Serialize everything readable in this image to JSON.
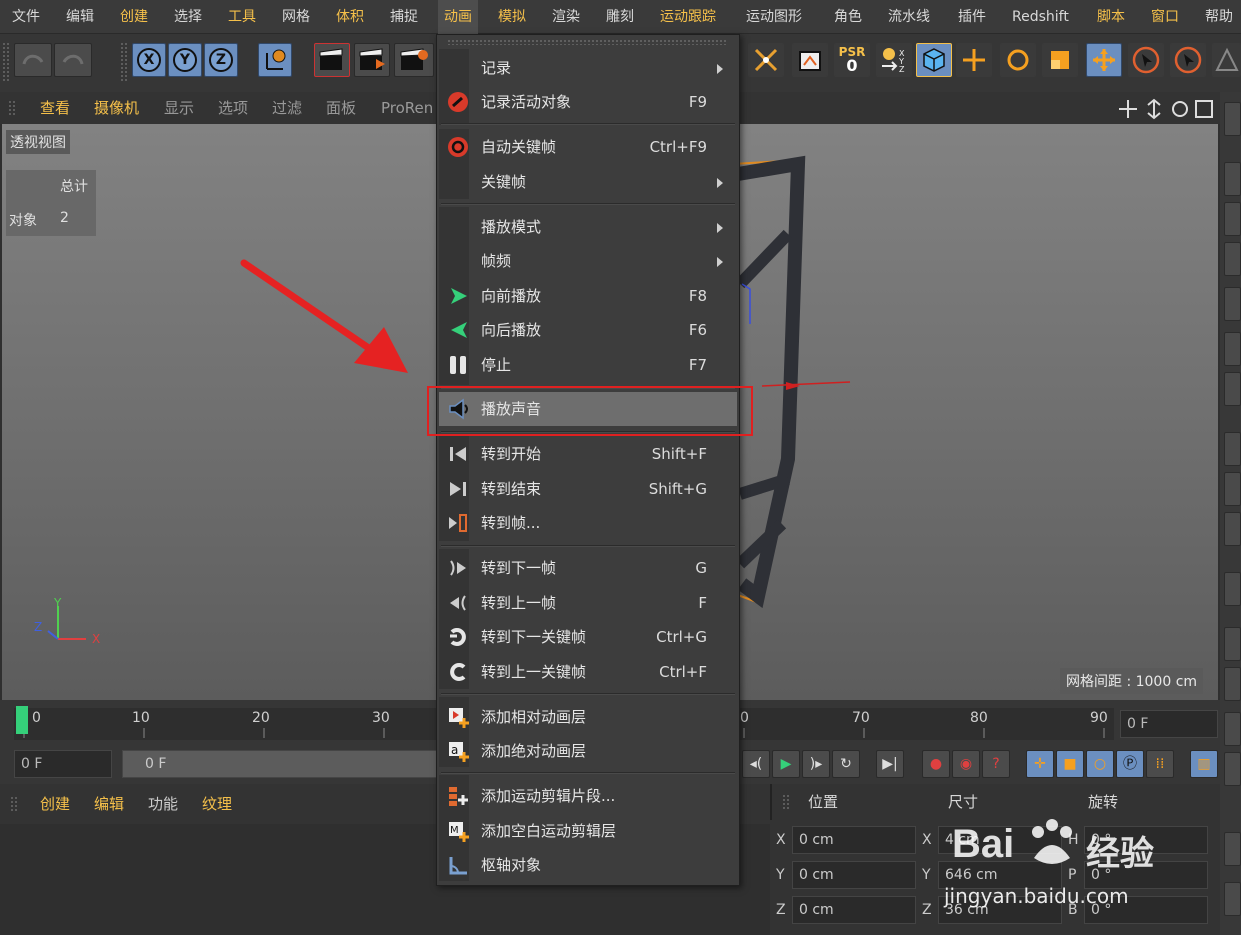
{
  "menubar": {
    "items": [
      "文件",
      "编辑",
      "创建",
      "选择",
      "工具",
      "网格",
      "体积",
      "捕捉",
      "动画",
      "模拟",
      "渲染",
      "雕刻",
      "运动跟踪",
      "运动图形",
      "角色",
      "流水线",
      "插件",
      "Redshift",
      "脚本",
      "窗口",
      "帮助"
    ]
  },
  "toolbar": {
    "x_label": "X",
    "y_label": "Y",
    "z_label": "Z",
    "psr_label": "PSR",
    "psr_value": "0"
  },
  "viewport_bar": {
    "items": [
      "查看",
      "摄像机",
      "显示",
      "选项",
      "过滤",
      "面板",
      "ProRen"
    ]
  },
  "viewport": {
    "label": "透视视图",
    "stats_header": "总计",
    "stats_row_label": "对象",
    "stats_row_value": "2",
    "grid_spacing": "网格间距 : 1000 cm",
    "axis_y": "Y",
    "axis_z": "Z",
    "axis_x": "X"
  },
  "timeline": {
    "ticks": [
      "0",
      "10",
      "20",
      "30",
      "",
      "70",
      "80",
      "90"
    ],
    "tick_last_hidden": "0",
    "frame_right": "0 F",
    "frame_left": "0 F",
    "slider_value": "0 F"
  },
  "bottom_bar": {
    "items": [
      "创建",
      "编辑",
      "功能",
      "纹理"
    ]
  },
  "attributes": {
    "headers": [
      "位置",
      "尺寸",
      "旋转"
    ],
    "rows": [
      {
        "axis": "X",
        "pos": "0 cm",
        "size": "4 cm",
        "rot_axis": "H",
        "rot": "0 °"
      },
      {
        "axis": "Y",
        "pos": "0 cm",
        "size": "646 cm",
        "rot_axis": "P",
        "rot": "0 °"
      },
      {
        "axis": "Z",
        "pos": "0 cm",
        "size": "36 cm",
        "rot_axis": "B",
        "rot": "0 °"
      }
    ]
  },
  "menu": {
    "items": [
      {
        "label": "记录",
        "shortcut": "",
        "submenu": true,
        "icon": "none"
      },
      {
        "label": "记录活动对象",
        "shortcut": "F9",
        "submenu": false,
        "icon": "record-icon"
      },
      {
        "label": "自动关键帧",
        "shortcut": "Ctrl+F9",
        "submenu": false,
        "icon": "autokey-icon"
      },
      {
        "label": "关键帧",
        "shortcut": "",
        "submenu": true,
        "icon": "none"
      },
      {
        "label": "播放模式",
        "shortcut": "",
        "submenu": true,
        "icon": "none"
      },
      {
        "label": "帧频",
        "shortcut": "",
        "submenu": true,
        "icon": "none"
      },
      {
        "label": "向前播放",
        "shortcut": "F8",
        "submenu": false,
        "icon": "play-forward-icon"
      },
      {
        "label": "向后播放",
        "shortcut": "F6",
        "submenu": false,
        "icon": "play-backward-icon"
      },
      {
        "label": "停止",
        "shortcut": "F7",
        "submenu": false,
        "icon": "stop-icon"
      },
      {
        "label": "播放声音",
        "shortcut": "",
        "submenu": false,
        "icon": "speaker-icon"
      },
      {
        "label": "转到开始",
        "shortcut": "Shift+F",
        "submenu": false,
        "icon": "go-start-icon"
      },
      {
        "label": "转到结束",
        "shortcut": "Shift+G",
        "submenu": false,
        "icon": "go-end-icon"
      },
      {
        "label": "转到帧...",
        "shortcut": "",
        "submenu": false,
        "icon": "go-frame-icon"
      },
      {
        "label": "转到下一帧",
        "shortcut": "G",
        "submenu": false,
        "icon": "next-frame-icon"
      },
      {
        "label": "转到上一帧",
        "shortcut": "F",
        "submenu": false,
        "icon": "prev-frame-icon"
      },
      {
        "label": "转到下一关键帧",
        "shortcut": "Ctrl+G",
        "submenu": false,
        "icon": "next-key-icon"
      },
      {
        "label": "转到上一关键帧",
        "shortcut": "Ctrl+F",
        "submenu": false,
        "icon": "prev-key-icon"
      },
      {
        "label": "添加相对动画层",
        "shortcut": "",
        "submenu": false,
        "icon": "add-relative-layer-icon"
      },
      {
        "label": "添加绝对动画层",
        "shortcut": "",
        "submenu": false,
        "icon": "add-absolute-layer-icon"
      },
      {
        "label": "添加运动剪辑片段...",
        "shortcut": "",
        "submenu": false,
        "icon": "motion-clip-icon"
      },
      {
        "label": "添加空白运动剪辑层",
        "shortcut": "",
        "submenu": false,
        "icon": "empty-motion-layer-icon"
      },
      {
        "label": "枢轴对象",
        "shortcut": "",
        "submenu": false,
        "icon": "pivot-object-icon"
      }
    ]
  },
  "watermark": {
    "brand": "Bai",
    "brand2": "经验",
    "url": "jingyan.baidu.com"
  },
  "colors": {
    "accent": "#f5c04a",
    "highlight_box": "#e02020",
    "arrow": "#e52222",
    "play_green": "#35d07a"
  }
}
